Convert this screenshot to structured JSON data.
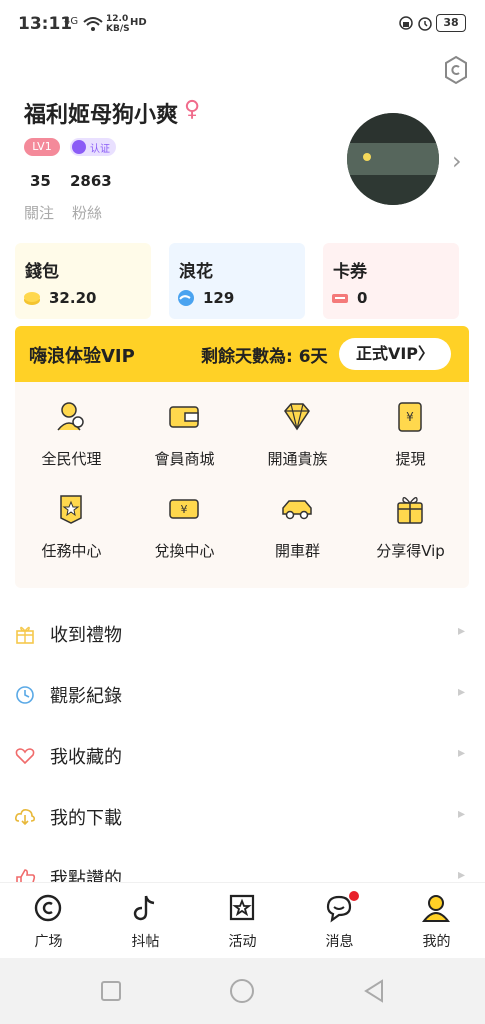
{
  "status_bar": {
    "time": "13:11",
    "network": "4G",
    "speed": "12.0\nKB/S",
    "hd": "HD",
    "battery": "38"
  },
  "profile": {
    "name": "福利姬母狗小爽",
    "gender_symbol": "♀",
    "level": "LV1",
    "cert_label": "认证",
    "following_count": "35",
    "following_label": "關注",
    "fans_count": "2863",
    "fans_label": "粉絲"
  },
  "wallet": {
    "cards": [
      {
        "title": "錢包",
        "value": "32.20",
        "bg": "#fffbe9",
        "icon": "coin-icon"
      },
      {
        "title": "浪花",
        "value": "129",
        "bg": "#eef6ff",
        "icon": "wave-icon"
      },
      {
        "title": "卡券",
        "value": "0",
        "bg": "#fff2f2",
        "icon": "ticket-icon"
      }
    ]
  },
  "vip": {
    "title": "嗨浪体验VIP",
    "days_text": "剩餘天數為: 6天",
    "button_label": "正式VIP",
    "accent": "#ffd126"
  },
  "grid": {
    "items": [
      {
        "label": "全民代理",
        "icon": "agent-icon"
      },
      {
        "label": "會員商城",
        "icon": "wallet-store-icon"
      },
      {
        "label": "開通貴族",
        "icon": "diamond-icon"
      },
      {
        "label": "提現",
        "icon": "withdraw-icon"
      },
      {
        "label": "任務中心",
        "icon": "task-icon"
      },
      {
        "label": "兌換中心",
        "icon": "exchange-icon"
      },
      {
        "label": "開車群",
        "icon": "car-icon"
      },
      {
        "label": "分享得Vip",
        "icon": "gift-icon"
      }
    ]
  },
  "menu": {
    "items": [
      {
        "label": "收到禮物",
        "icon": "gift-icon"
      },
      {
        "label": "觀影紀錄",
        "icon": "clock-icon"
      },
      {
        "label": "我收藏的",
        "icon": "heart-icon"
      },
      {
        "label": "我的下載",
        "icon": "download-icon"
      },
      {
        "label": "我點讚的",
        "icon": "thumb-icon"
      }
    ]
  },
  "tabs": [
    {
      "label": "广场",
      "icon": "square-icon"
    },
    {
      "label": "抖帖",
      "icon": "tiktok-icon"
    },
    {
      "label": "活动",
      "icon": "star-icon"
    },
    {
      "label": "消息",
      "icon": "message-icon"
    },
    {
      "label": "我的",
      "icon": "user-icon"
    }
  ]
}
